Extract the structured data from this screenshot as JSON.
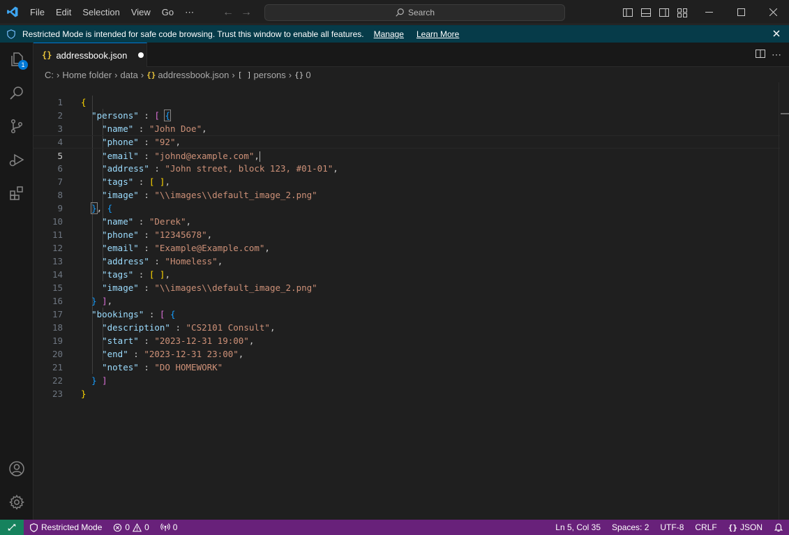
{
  "menu": [
    "File",
    "Edit",
    "Selection",
    "View",
    "Go",
    "⋯"
  ],
  "search": {
    "label": "Search"
  },
  "banner": {
    "text": "Restricted Mode is intended for safe code browsing. Trust this window to enable all features.",
    "manage": "Manage",
    "learn_more": "Learn More"
  },
  "activity": {
    "explorer_badge": "1"
  },
  "tab": {
    "label": "addressbook.json",
    "icon": "{}"
  },
  "breadcrumb": {
    "drive": "C:",
    "folder1": "Home folder",
    "folder2": "data",
    "file": "addressbook.json",
    "file_icon": "{}",
    "node1": "persons",
    "node1_icon": "[ ]",
    "node2": "0",
    "node2_icon": "{}"
  },
  "editor": {
    "line_numbers": [
      "1",
      "2",
      "3",
      "4",
      "5",
      "6",
      "7",
      "8",
      "9",
      "10",
      "11",
      "12",
      "13",
      "14",
      "15",
      "16",
      "17",
      "18",
      "19",
      "20",
      "21",
      "22",
      "23"
    ],
    "tokens": {
      "persons_key": "\"persons\"",
      "bookings_key": "\"bookings\"",
      "p0": {
        "name_k": "\"name\"",
        "name_v": "\"John Doe\"",
        "phone_k": "\"phone\"",
        "phone_v": "\"92\"",
        "email_k": "\"email\"",
        "email_v": "\"johnd@example.com\"",
        "address_k": "\"address\"",
        "address_v": "\"John street, block 123, #01-01\"",
        "tags_k": "\"tags\"",
        "image_k": "\"image\"",
        "image_v": "\"\\\\images\\\\default_image_2.png\""
      },
      "p1": {
        "name_k": "\"name\"",
        "name_v": "\"Derek\"",
        "phone_k": "\"phone\"",
        "phone_v": "\"12345678\"",
        "email_k": "\"email\"",
        "email_v": "\"Example@Example.com\"",
        "address_k": "\"address\"",
        "address_v": "\"Homeless\"",
        "tags_k": "\"tags\"",
        "image_k": "\"image\"",
        "image_v": "\"\\\\images\\\\default_image_2.png\""
      },
      "b0": {
        "description_k": "\"description\"",
        "description_v": "\"CS2101 Consult\"",
        "start_k": "\"start\"",
        "start_v": "\"2023-12-31 19:00\"",
        "end_k": "\"end\"",
        "end_v": "\"2023-12-31 23:00\"",
        "notes_k": "\"notes\"",
        "notes_v": "\"DO HOMEWORK\""
      }
    }
  },
  "status": {
    "restricted": "Restricted Mode",
    "errors": "0",
    "warnings": "0",
    "ports": "0",
    "position": "Ln 5, Col 35",
    "spaces": "Spaces: 2",
    "encoding": "UTF-8",
    "eol": "CRLF",
    "language": "JSON",
    "language_icon": "{}"
  },
  "colors": {
    "statusbar": "#68217a",
    "banner": "#063b49",
    "accent": "#0078d4",
    "string": "#ce9178",
    "key": "#9cdcfe"
  }
}
